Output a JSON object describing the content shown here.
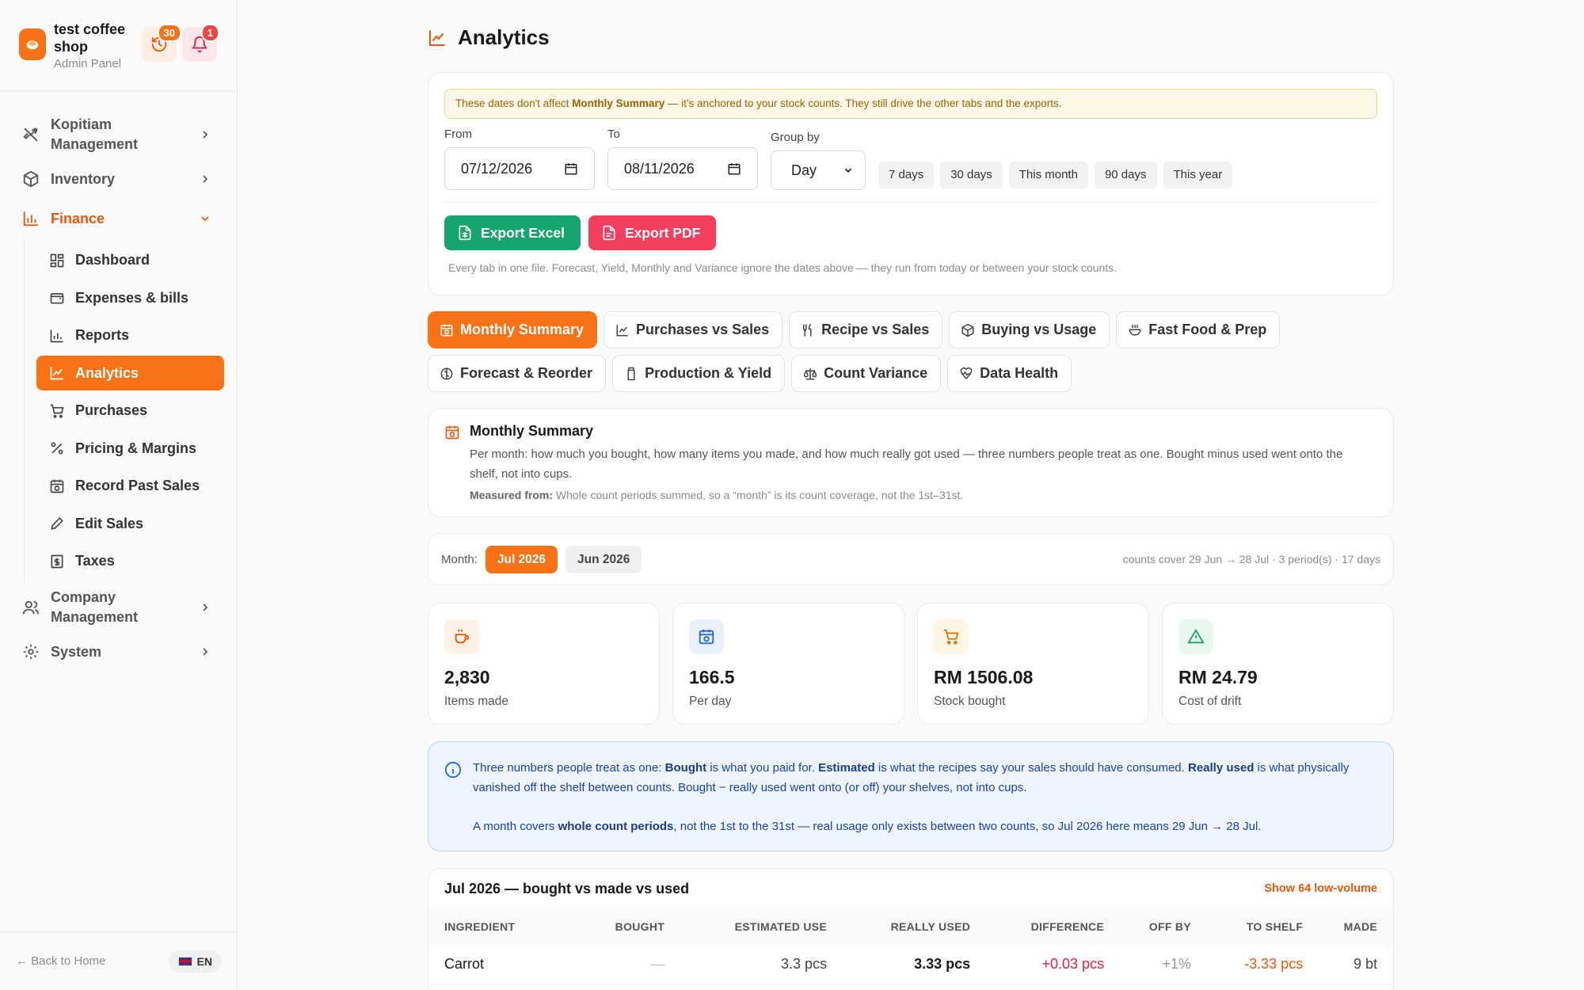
{
  "brand": {
    "name": "test coffee shop",
    "subtitle": "Admin Panel",
    "history_count": "30",
    "notification_count": "1"
  },
  "nav": {
    "groups": [
      {
        "label": "Kopitiam Management"
      },
      {
        "label": "Inventory"
      },
      {
        "label": "Finance"
      },
      {
        "label": "Company Management"
      },
      {
        "label": "System"
      }
    ],
    "finance_items": [
      {
        "label": "Dashboard",
        "icon": "dashboard-icon"
      },
      {
        "label": "Expenses & bills",
        "icon": "wallet-icon"
      },
      {
        "label": "Reports",
        "icon": "bar-chart-icon"
      },
      {
        "label": "Analytics",
        "icon": "line-chart-icon"
      },
      {
        "label": "Purchases",
        "icon": "cart-icon"
      },
      {
        "label": "Pricing & Margins",
        "icon": "percent-icon"
      },
      {
        "label": "Record Past Sales",
        "icon": "calendar-clock-icon"
      },
      {
        "label": "Edit Sales",
        "icon": "pencil-icon"
      },
      {
        "label": "Taxes",
        "icon": "receipt-icon"
      }
    ]
  },
  "footer": {
    "back": "← Back to Home",
    "lang": "EN"
  },
  "page": {
    "title": "Analytics"
  },
  "filters": {
    "notice_pre": "These dates don't affect ",
    "notice_bold": "Monthly Summary",
    "notice_post": " — it's anchored to your stock counts. They still drive the other tabs and the exports.",
    "from_label": "From",
    "from_value": "07/12/2026",
    "to_label": "To",
    "to_value": "08/11/2026",
    "group_label": "Group by",
    "group_value": "Day",
    "presets": [
      "7 days",
      "30 days",
      "This month",
      "90 days",
      "This year"
    ],
    "export_excel": "Export Excel",
    "export_pdf": "Export PDF",
    "helper": "Every tab in one file. Forecast, Yield, Monthly and Variance ignore the dates above — they run from today or between your stock counts."
  },
  "tabs": {
    "row1": [
      "Monthly Summary",
      "Purchases vs Sales",
      "Recipe vs Sales",
      "Buying vs Usage",
      "Fast Food & Prep"
    ],
    "row2": [
      "Forecast & Reorder",
      "Production & Yield",
      "Count Variance",
      "Data Health"
    ]
  },
  "summary": {
    "title": "Monthly Summary",
    "description": "Per month: how much you bought, how many items you made, and how much really got used — three numbers people treat as one. Bought minus used went onto the shelf, not into cups.",
    "measured_label": "Measured from:",
    "measured_text": "Whole count periods summed, so a “month” is its count coverage, not the 1st–31st."
  },
  "month": {
    "label": "Month:",
    "options": [
      "Jul 2026",
      "Jun 2026"
    ],
    "coverage": "counts cover 29 Jun → 28 Jul · 3 period(s) · 17 days"
  },
  "stats": [
    {
      "value": "2,830",
      "label": "Items made"
    },
    {
      "value": "166.5",
      "label": "Per day"
    },
    {
      "value": "RM 1506.08",
      "label": "Stock bought"
    },
    {
      "value": "RM 24.79",
      "label": "Cost of drift"
    }
  ],
  "info": {
    "p1_a": "Three numbers people treat as one: ",
    "p1_b": "Bought",
    "p1_c": " is what you paid for. ",
    "p1_d": "Estimated",
    "p1_e": " is what the recipes say your sales should have consumed. ",
    "p1_f": "Really used",
    "p1_g": " is what physically vanished off the shelf between counts. Bought − really used went onto (or off) your shelves, not into cups.",
    "p2_a": "A month covers ",
    "p2_b": "whole count periods",
    "p2_c": ", not the 1st to the 31st — real usage only exists between two counts, so Jul 2026 here means 29 Jun → 28 Jul."
  },
  "table": {
    "title": "Jul 2026 — bought vs made vs used",
    "link": "Show 64 low-volume",
    "headers": [
      "Ingredient",
      "Bought",
      "Estimated use",
      "Really used",
      "Difference",
      "Off by",
      "To shelf",
      "Made"
    ],
    "rows": [
      [
        "Carrot",
        "—",
        "3.3 pcs",
        "3.33 pcs",
        "+0.03 pcs",
        "+1%",
        "-3.33 pcs",
        "9 bt"
      ]
    ]
  },
  "colors": {
    "accent": "#f97316",
    "excel": "#16a571",
    "pdf": "#f43f5e",
    "info_bg": "#eef5ff",
    "notice_bg": "#fff8e6"
  }
}
